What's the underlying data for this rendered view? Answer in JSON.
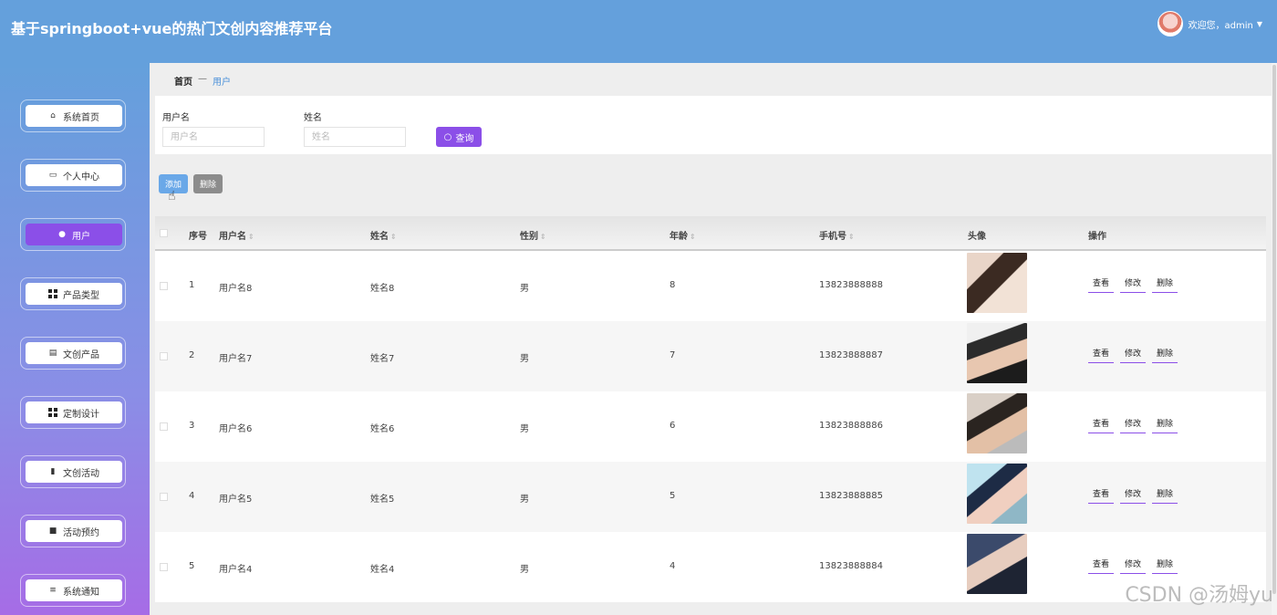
{
  "app": {
    "title": "基于springboot+vue的热门文创内容推荐平台"
  },
  "user": {
    "greeting": "欢迎您，admin",
    "caret": "▼"
  },
  "sidebar": {
    "items": [
      {
        "label": "系统首页",
        "icon": "home-icon",
        "active": false
      },
      {
        "label": "个人中心",
        "icon": "card-icon",
        "active": false
      },
      {
        "label": "用户",
        "icon": "user-icon",
        "active": true
      },
      {
        "label": "产品类型",
        "icon": "grid-icon",
        "active": false
      },
      {
        "label": "文创产品",
        "icon": "clipboard-icon",
        "active": false
      },
      {
        "label": "定制设计",
        "icon": "grid-icon",
        "active": false
      },
      {
        "label": "文创活动",
        "icon": "bar-chart-icon",
        "active": false
      },
      {
        "label": "活动预约",
        "icon": "message-icon",
        "active": false
      },
      {
        "label": "系统通知",
        "icon": "list-icon",
        "active": false
      }
    ]
  },
  "breadcrumb": {
    "home": "首页",
    "sep": "—",
    "current": "用户"
  },
  "search": {
    "username_label": "用户名",
    "username_placeholder": "用户名",
    "name_label": "姓名",
    "name_placeholder": "姓名",
    "query_label": "查询"
  },
  "actions": {
    "add_label": "添加",
    "delete_label": "删除"
  },
  "table": {
    "headers": {
      "index": "序号",
      "username": "用户名",
      "name": "姓名",
      "gender": "性别",
      "age": "年龄",
      "phone": "手机号",
      "avatar": "头像",
      "ops": "操作"
    },
    "sort_glyph": "⇕",
    "ops": {
      "view": "查看",
      "edit": "修改",
      "delete": "删除"
    },
    "rows": [
      {
        "index": "1",
        "username": "用户名8",
        "name": "姓名8",
        "gender": "男",
        "age": "8",
        "phone": "13823888888"
      },
      {
        "index": "2",
        "username": "用户名7",
        "name": "姓名7",
        "gender": "男",
        "age": "7",
        "phone": "13823888887"
      },
      {
        "index": "3",
        "username": "用户名6",
        "name": "姓名6",
        "gender": "男",
        "age": "6",
        "phone": "13823888886"
      },
      {
        "index": "4",
        "username": "用户名5",
        "name": "姓名5",
        "gender": "男",
        "age": "5",
        "phone": "13823888885"
      },
      {
        "index": "5",
        "username": "用户名4",
        "name": "姓名4",
        "gender": "男",
        "age": "4",
        "phone": "13823888884"
      }
    ]
  },
  "watermark": "CSDN @汤姆yu",
  "colors": {
    "topbar": "#64a0dc",
    "accent": "#8b4fe8",
    "add": "#6aa8e8",
    "delete": "#8c8c8c"
  }
}
